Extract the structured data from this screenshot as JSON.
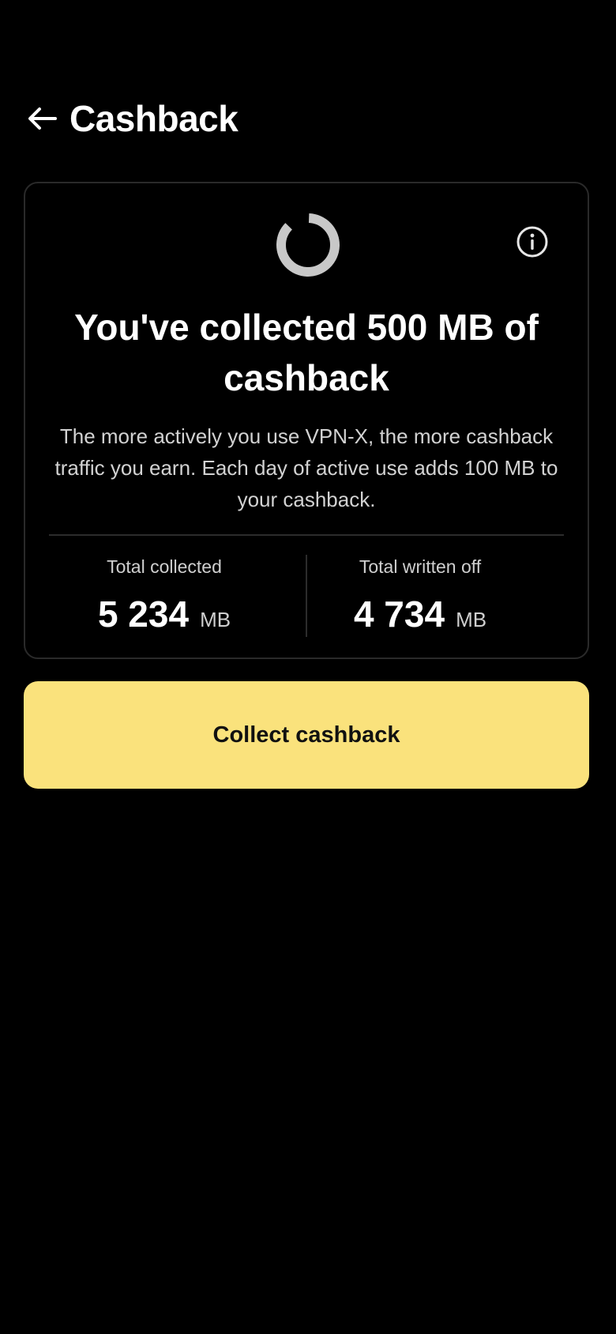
{
  "header": {
    "title": "Cashback",
    "back_icon": "arrow-left-icon"
  },
  "card": {
    "info_icon": "info-icon",
    "progress_icon": "progress-ring-icon",
    "title": "You've collected 500 MB of cashback",
    "description": "The more actively you use VPN-X, the more cashback traffic you earn. Each day of active use adds 100 MB to your cashback.",
    "stats": {
      "collected": {
        "label": "Total collected",
        "value": "5 234",
        "unit": "MB"
      },
      "written_off": {
        "label": "Total written off",
        "value": "4 734",
        "unit": "MB"
      }
    }
  },
  "actions": {
    "collect_label": "Collect cashback"
  },
  "colors": {
    "background": "#000000",
    "accent": "#fae27c",
    "ring": "#c8c8c8",
    "card_border": "#2a2a2a"
  }
}
